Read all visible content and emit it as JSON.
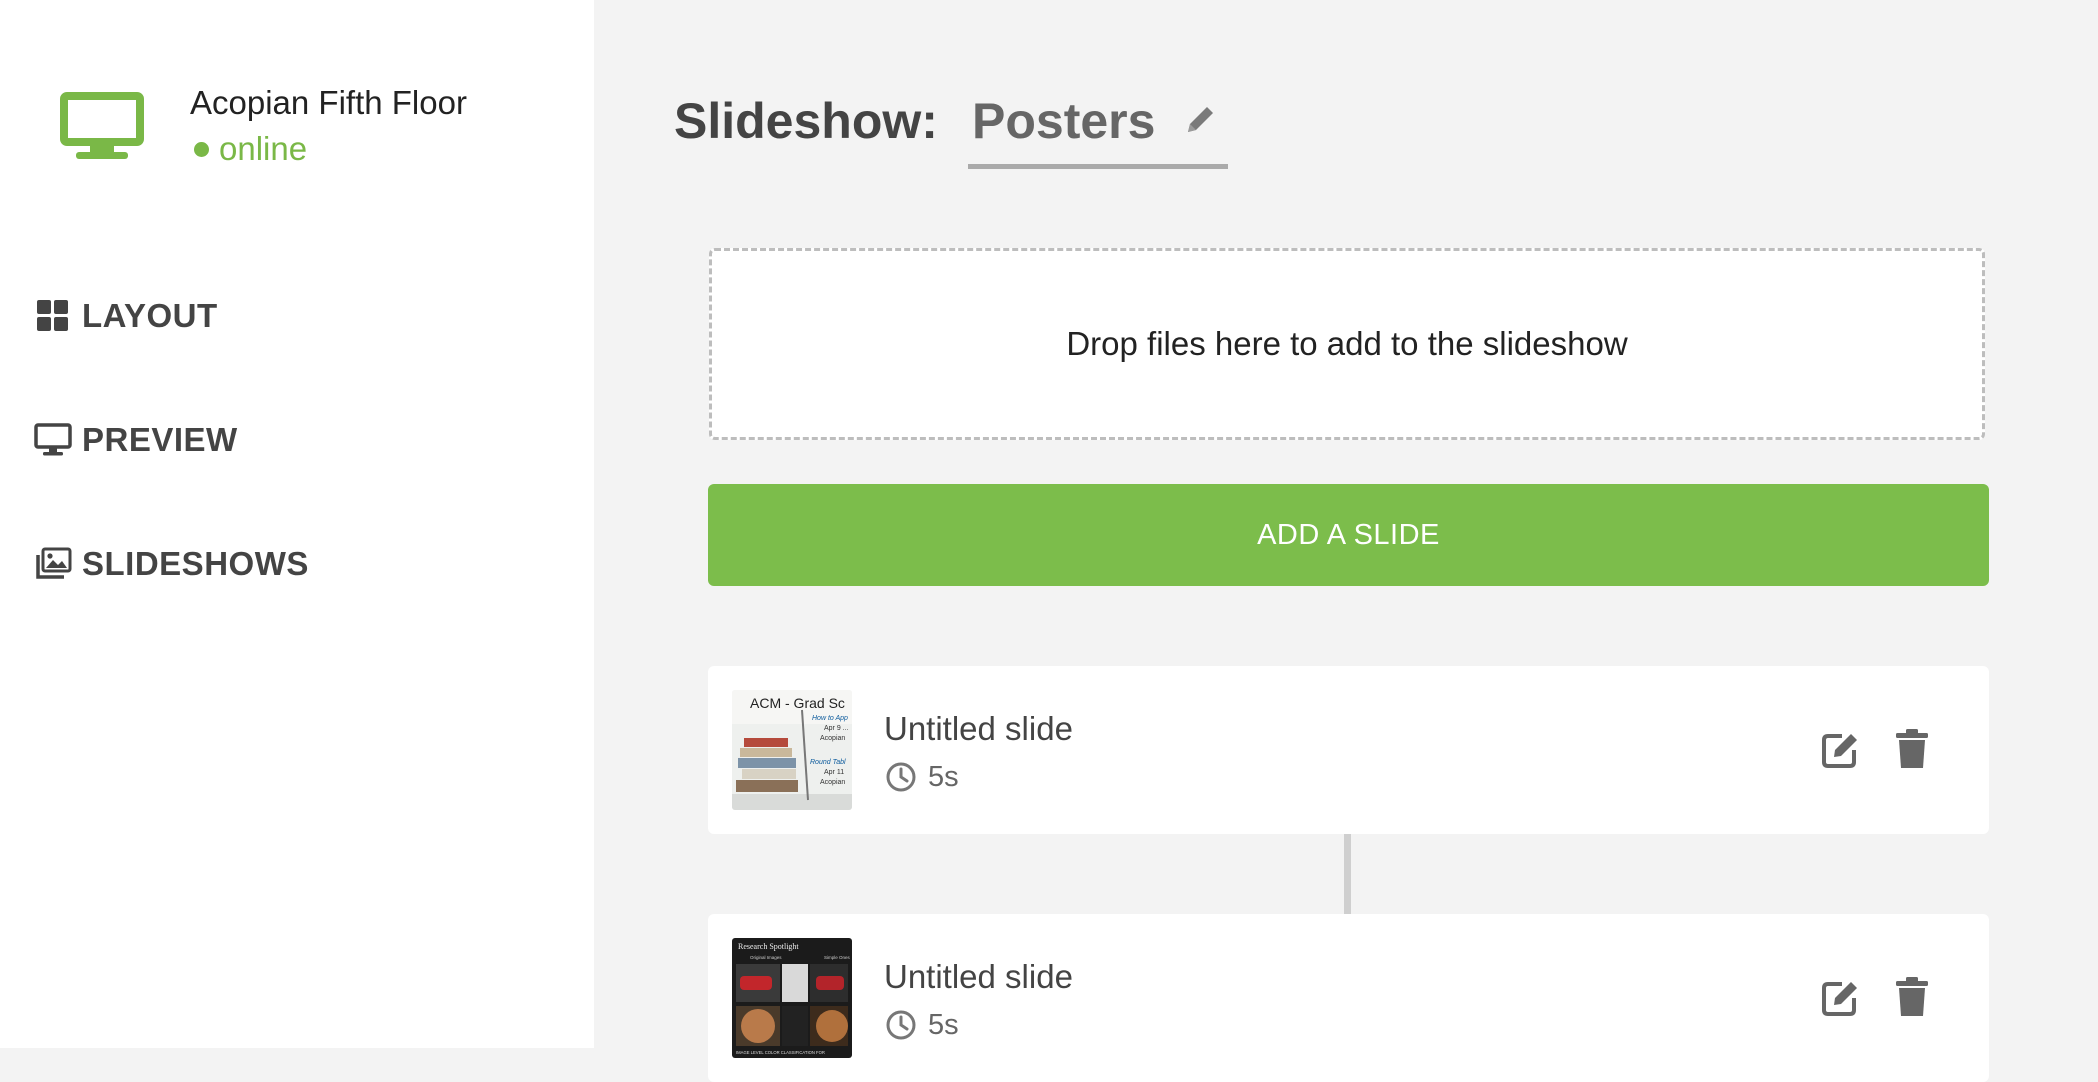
{
  "sidebar": {
    "display": {
      "icon": "monitor-icon",
      "name": "Acopian Fifth Floor",
      "status": "online",
      "status_color": "#7ab847"
    },
    "nav": [
      {
        "label": "LAYOUT",
        "icon": "grid-icon"
      },
      {
        "label": "PREVIEW",
        "icon": "monitor-icon"
      },
      {
        "label": "SLIDESHOWS",
        "icon": "images-icon"
      }
    ]
  },
  "main": {
    "title_prefix": "Slideshow:",
    "title_value": "Posters",
    "dropzone_text": "Drop files here to add to the slideshow",
    "add_button_label": "ADD A SLIDE",
    "accent_color": "#7cbd4b",
    "slides": [
      {
        "title": "Untitled slide",
        "duration": "5s",
        "thumbnail": {
          "line1": "ACM - Grad Sc",
          "line2": "How to App",
          "line3": "Apr 9 ...",
          "line4": "Acopian",
          "line5": "Round Tabl",
          "line6": "Apr 11",
          "line7": "Acopian"
        }
      },
      {
        "title": "Untitled slide",
        "duration": "5s",
        "thumbnail": {
          "heading": "Research Spotlight",
          "left_label": "Original Images",
          "right_label": "Simple Ones",
          "footer": "IMAGE LEVEL COLOR CLASSIFICATION FOR"
        }
      }
    ]
  }
}
